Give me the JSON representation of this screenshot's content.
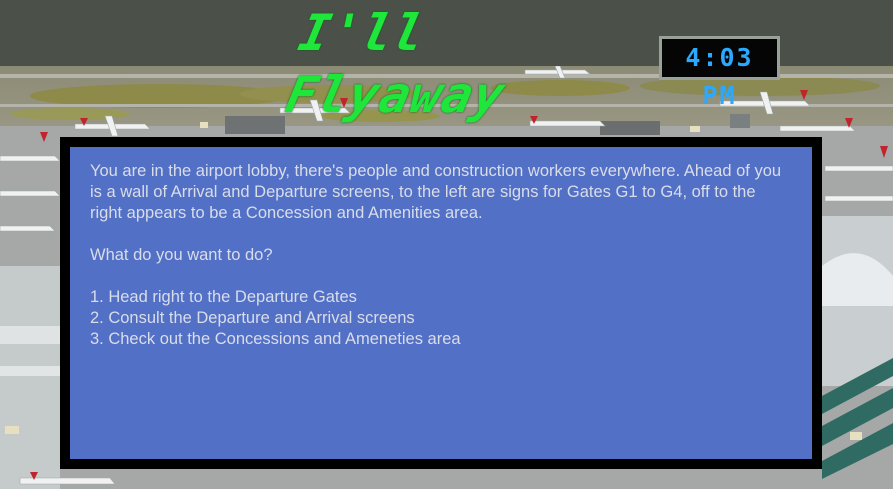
{
  "game": {
    "title": "I'll Flyaway",
    "clock": "4:03 PM"
  },
  "dialogue": {
    "description": "You are in the airport lobby, there's people and construction workers everywhere. Ahead of you is a wall of Arrival and Departure screens, to the left are signs for Gates G1 to G4, off to the right appears to be a Concession and Amenities area.",
    "prompt": "What do you want to do?",
    "options": [
      "1. Head right to the Departure Gates",
      "2. Consult the Departure and Arrival screens",
      "3. Check out the Concessions and Ameneties area"
    ]
  },
  "colors": {
    "title": "#1ee63a",
    "clock": "#2aa9ff",
    "panel": "#5370c7",
    "header": "#4b5149"
  },
  "icons": {
    "background": "airport-aerial-image"
  }
}
